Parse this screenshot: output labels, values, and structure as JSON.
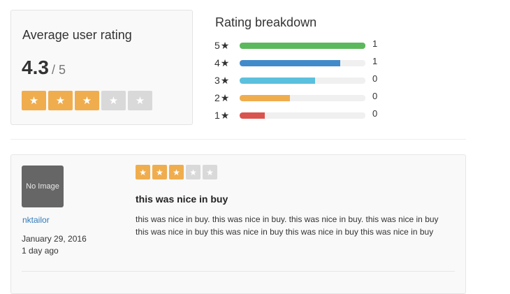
{
  "average": {
    "title": "Average user rating",
    "score": "4.3",
    "out_of": "/ 5",
    "stars_filled": 3,
    "stars_total": 5
  },
  "breakdown": {
    "title": "Rating breakdown",
    "star_glyph": "★",
    "rows": [
      {
        "label": "5",
        "count": "1",
        "fraction": 1.0,
        "color": "#5cb85c"
      },
      {
        "label": "4",
        "count": "1",
        "fraction": 0.8,
        "color": "#428bca"
      },
      {
        "label": "3",
        "count": "0",
        "fraction": 0.6,
        "color": "#5bc0de"
      },
      {
        "label": "2",
        "count": "0",
        "fraction": 0.4,
        "color": "#f0ad4e"
      },
      {
        "label": "1",
        "count": "0",
        "fraction": 0.2,
        "color": "#d9534f"
      }
    ]
  },
  "review": {
    "avatar_text": "No Image",
    "username": "nktailor",
    "date": "January 29, 2016",
    "ago": "1 day ago",
    "stars_filled": 3,
    "stars_total": 5,
    "title": "this was nice in buy",
    "body": "this was nice in buy. this was nice in buy. this was nice in buy. this was nice in buy this was nice in buy this was nice in buy this was nice in buy this was nice in buy"
  },
  "colors": {
    "star_on": "#f0ad4e",
    "star_off": "#d9d9d9",
    "link": "#337ab7"
  },
  "icons": {
    "star": "star-icon"
  }
}
